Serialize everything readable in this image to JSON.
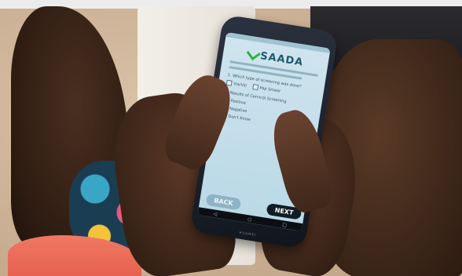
{
  "app": {
    "logo_text": "SAADA",
    "logo_color": "#2fb04a",
    "question_1": "1. Which type of screening was done?",
    "q1_options": [
      "Via/Vili",
      "Pap Smear"
    ],
    "question_2": "2. Results of Cervical Screening",
    "q2_options": [
      "Positive",
      "Negative",
      "Don't Know"
    ],
    "back_label": "BACK",
    "next_label": "NEXT",
    "nav_icons": [
      "back-triangle-icon",
      "home-circle-icon",
      "recents-square-icon"
    ],
    "nav_glyphs": [
      "◁",
      "○",
      "□"
    ],
    "brand": "HUAWEI"
  }
}
